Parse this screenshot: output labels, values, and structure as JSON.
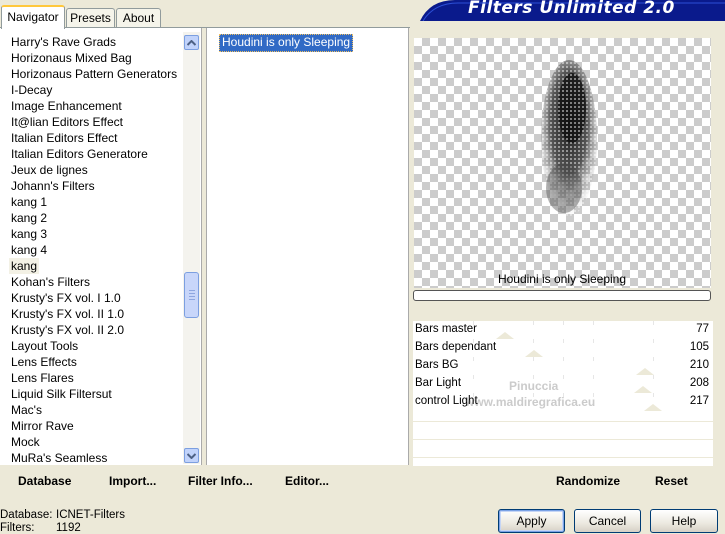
{
  "app": {
    "title": "Filters Unlimited 2.0"
  },
  "tabs": [
    {
      "label": "Navigator",
      "active": true
    },
    {
      "label": "Presets",
      "active": false
    },
    {
      "label": "About",
      "active": false
    }
  ],
  "categories": [
    "Harry's Rave Grads",
    "Horizonaus Mixed Bag",
    "Horizonaus Pattern Generators",
    "I-Decay",
    "Image Enhancement",
    "It@lian Editors Effect",
    "Italian Editors Effect",
    "Italian Editors Generatore",
    "Jeux de lignes",
    "Johann's Filters",
    "kang 1",
    "kang 2",
    "kang 3",
    "kang 4",
    "kang",
    "Kohan's Filters",
    "Krusty's FX vol. I 1.0",
    "Krusty's FX vol. II 1.0",
    "Krusty's FX vol. II 2.0",
    "Layout Tools",
    "Lens Effects",
    "Lens Flares",
    "Liquid Silk Filtersut",
    "Mac's",
    "Mirror Rave",
    "Mock",
    "MuRa's Seamless"
  ],
  "selected_category": "kang",
  "filters": [
    "Houdini is only Sleeping"
  ],
  "selected_filter": "Houdini is only Sleeping",
  "preview": {
    "filter_name": "Houdini is only Sleeping"
  },
  "sliders": [
    {
      "label": "Bars master",
      "value": 77
    },
    {
      "label": "Bars dependant",
      "value": 105
    },
    {
      "label": "Bars BG",
      "value": 210
    },
    {
      "label": "Bar Light",
      "value": 208
    },
    {
      "label": "control Light",
      "value": 217
    }
  ],
  "watermark": {
    "line1": "Pinuccia",
    "line2": "www.maldiregrafica.eu"
  },
  "buttons": {
    "database": "Database",
    "import": "Import...",
    "filter_info": "Filter Info...",
    "editor": "Editor...",
    "randomize": "Randomize",
    "reset": "Reset",
    "apply": "Apply",
    "cancel": "Cancel",
    "help": "Help"
  },
  "status": {
    "database_label": "Database:",
    "database_value": "ICNET-Filters",
    "filters_label": "Filters:",
    "filters_value": "1192"
  },
  "colors": {
    "window_bg": "#ece9d8",
    "selection": "#316ac5",
    "banner": "#0a1a8c"
  },
  "icons": {
    "scroll_up": "chevron-up-icon",
    "scroll_down": "chevron-down-icon"
  }
}
